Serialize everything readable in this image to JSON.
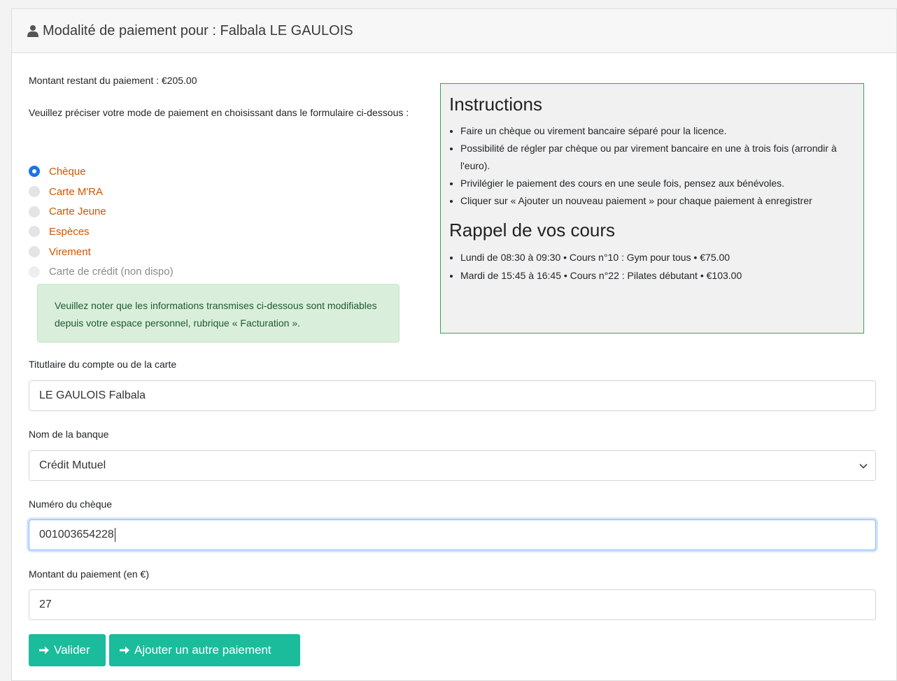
{
  "header": {
    "title": "Modalité de paiement pour : Falbala LE GAULOIS",
    "icon": "user-icon"
  },
  "amount_remaining": "Montant restant du paiement : €205.00",
  "intro_text": "Veuillez préciser votre mode de paiement en choisissant dans le formulaire ci-dessous :",
  "payment_methods": [
    {
      "label": "Chèque",
      "checked": true
    },
    {
      "label": "Carte M'RA",
      "checked": false
    },
    {
      "label": "Carte Jeune",
      "checked": false
    },
    {
      "label": "Espèces",
      "checked": false
    },
    {
      "label": "Virement",
      "checked": false
    },
    {
      "label": "Carte de crédit (non dispo)",
      "checked": false,
      "disabled": true
    }
  ],
  "note": "Veuillez noter que les informations transmises ci-dessous sont modifiables depuis votre espace personnel, rubrique « Facturation ».",
  "instructions": {
    "title": "Instructions",
    "items": [
      "Faire un chèque ou virement bancaire séparé pour la licence.",
      "Possibilité de régler par chèque ou par virement bancaire en une à trois fois (arrondir à l'euro).",
      "Privilégier le paiement des cours en une seule fois, pensez aux bénévoles.",
      "Cliquer sur « Ajouter un nouveau paiement » pour chaque paiement à enregistrer"
    ],
    "courses_title": "Rappel de vos cours",
    "courses": [
      "Lundi de 08:30 à 09:30 • Cours n°10 : Gym pour tous • €75.00",
      "Mardi de 15:45 à 16:45 • Cours n°22 : Pilates débutant • €103.00"
    ]
  },
  "form": {
    "holder_label": "Titutlaire du compte ou de la carte",
    "holder_value": "LE GAULOIS Falbala",
    "bank_label": "Nom de la banque",
    "bank_value": "Crédit Mutuel",
    "cheque_label": "Numéro du chèque",
    "cheque_value": "001003654228",
    "amount_label": "Montant du paiement (en €)",
    "amount_value": "27"
  },
  "buttons": {
    "validate": "Valider",
    "add_another": "Ajouter un autre paiement"
  },
  "colors": {
    "accent": "#1abc9c",
    "radio_label": "#d35400",
    "radio_checked": "#1a73e8",
    "instructions_border": "#2fa84f",
    "note_bg": "#d9efdc"
  }
}
